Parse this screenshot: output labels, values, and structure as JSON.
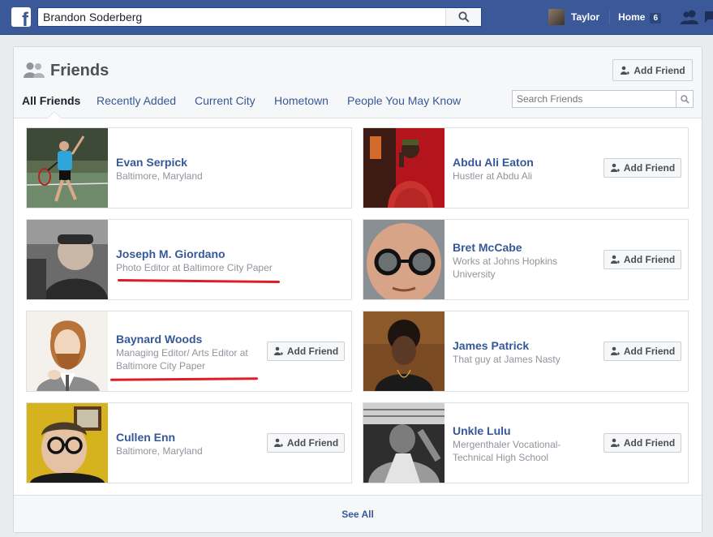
{
  "topbar": {
    "search_value": "Brandon Soderberg",
    "user_name": "Taylor",
    "home_label": "Home",
    "home_count": "6"
  },
  "colors": {
    "brand": "#3b5998",
    "link": "#365899",
    "annotation": "#e01b24"
  },
  "friends_page": {
    "title": "Friends",
    "add_friend_label": "Add Friend",
    "search_placeholder": "Search Friends",
    "tabs": [
      {
        "label": "All Friends",
        "active": true
      },
      {
        "label": "Recently Added",
        "active": false
      },
      {
        "label": "Current City",
        "active": false
      },
      {
        "label": "Hometown",
        "active": false
      },
      {
        "label": "People You May Know",
        "active": false
      }
    ],
    "friends": [
      {
        "name": "Evan Serpick",
        "lines": [
          "Baltimore, Maryland"
        ],
        "has_add_button": false
      },
      {
        "name": "Abdu Ali Eaton",
        "lines": [
          "Hustler at Abdu Ali"
        ],
        "has_add_button": true
      },
      {
        "name": "Joseph M. Giordano",
        "lines": [
          "Photo Editor at Baltimore City Paper"
        ],
        "has_add_button": false
      },
      {
        "name": "Bret McCabe",
        "lines": [
          "Works at Johns Hopkins",
          "University"
        ],
        "has_add_button": true
      },
      {
        "name": "Baynard Woods",
        "lines": [
          "Managing Editor/ Arts Editor at",
          "Baltimore City Paper"
        ],
        "has_add_button": true
      },
      {
        "name": "James Patrick",
        "lines": [
          "That guy at James Nasty"
        ],
        "has_add_button": true
      },
      {
        "name": "Cullen Enn",
        "lines": [
          "Baltimore, Maryland"
        ],
        "has_add_button": true
      },
      {
        "name": "Unkle Lulu",
        "lines": [
          "Mergenthaler Vocational-",
          "Technical High School"
        ],
        "has_add_button": true
      }
    ],
    "see_all_label": "See All"
  },
  "icons": {
    "logo": "facebook-logo-icon",
    "search": "search-icon",
    "friends": "friends-icon",
    "add_friend": "add-person-icon"
  }
}
